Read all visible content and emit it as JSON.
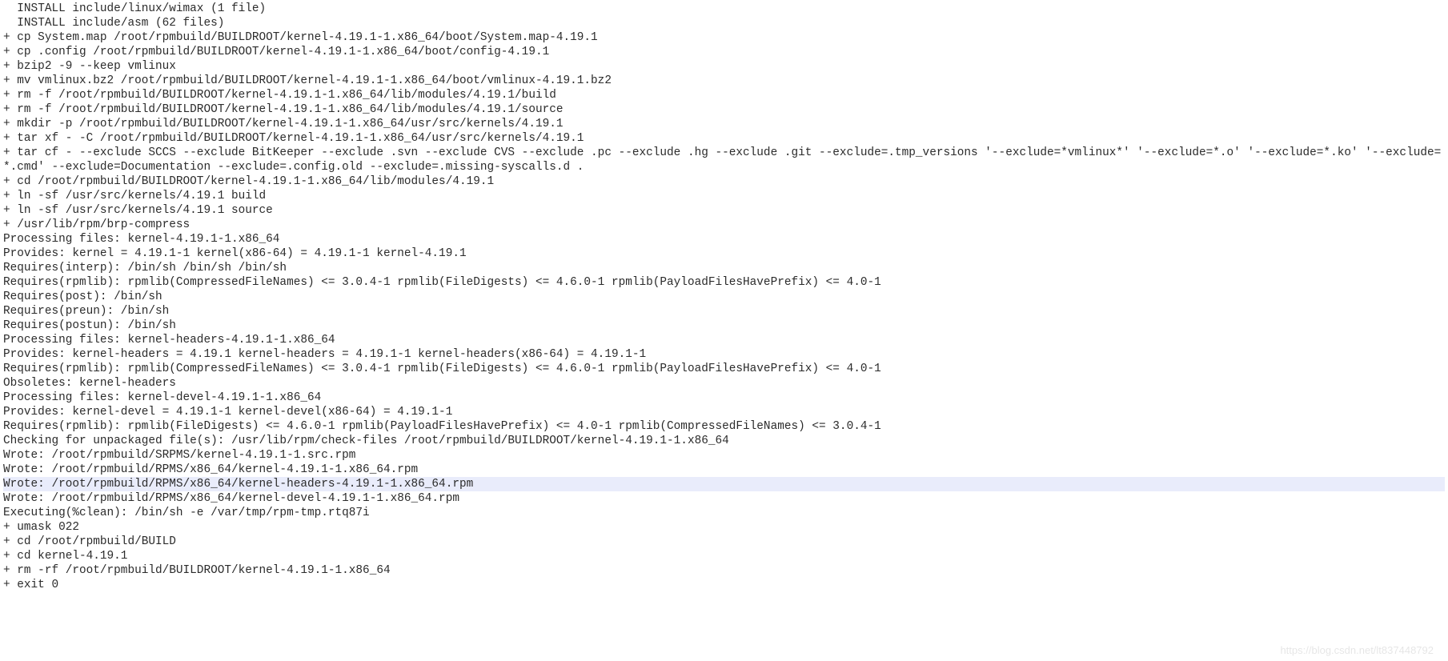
{
  "highlight_index": 33,
  "watermark": "https://blog.csdn.net/lt837448792",
  "lines": [
    "  INSTALL include/linux/wimax (1 file)",
    "  INSTALL include/asm (62 files)",
    "+ cp System.map /root/rpmbuild/BUILDROOT/kernel-4.19.1-1.x86_64/boot/System.map-4.19.1",
    "+ cp .config /root/rpmbuild/BUILDROOT/kernel-4.19.1-1.x86_64/boot/config-4.19.1",
    "+ bzip2 -9 --keep vmlinux",
    "+ mv vmlinux.bz2 /root/rpmbuild/BUILDROOT/kernel-4.19.1-1.x86_64/boot/vmlinux-4.19.1.bz2",
    "+ rm -f /root/rpmbuild/BUILDROOT/kernel-4.19.1-1.x86_64/lib/modules/4.19.1/build",
    "+ rm -f /root/rpmbuild/BUILDROOT/kernel-4.19.1-1.x86_64/lib/modules/4.19.1/source",
    "+ mkdir -p /root/rpmbuild/BUILDROOT/kernel-4.19.1-1.x86_64/usr/src/kernels/4.19.1",
    "+ tar xf - -C /root/rpmbuild/BUILDROOT/kernel-4.19.1-1.x86_64/usr/src/kernels/4.19.1",
    "+ tar cf - --exclude SCCS --exclude BitKeeper --exclude .svn --exclude CVS --exclude .pc --exclude .hg --exclude .git --exclude=.tmp_versions '--exclude=*vmlinux*' '--exclude=*.o' '--exclude=*.ko' '--exclude=*.cmd' --exclude=Documentation --exclude=.config.old --exclude=.missing-syscalls.d .",
    "+ cd /root/rpmbuild/BUILDROOT/kernel-4.19.1-1.x86_64/lib/modules/4.19.1",
    "+ ln -sf /usr/src/kernels/4.19.1 build",
    "+ ln -sf /usr/src/kernels/4.19.1 source",
    "+ /usr/lib/rpm/brp-compress",
    "Processing files: kernel-4.19.1-1.x86_64",
    "Provides: kernel = 4.19.1-1 kernel(x86-64) = 4.19.1-1 kernel-4.19.1",
    "Requires(interp): /bin/sh /bin/sh /bin/sh",
    "Requires(rpmlib): rpmlib(CompressedFileNames) <= 3.0.4-1 rpmlib(FileDigests) <= 4.6.0-1 rpmlib(PayloadFilesHavePrefix) <= 4.0-1",
    "Requires(post): /bin/sh",
    "Requires(preun): /bin/sh",
    "Requires(postun): /bin/sh",
    "Processing files: kernel-headers-4.19.1-1.x86_64",
    "Provides: kernel-headers = 4.19.1 kernel-headers = 4.19.1-1 kernel-headers(x86-64) = 4.19.1-1",
    "Requires(rpmlib): rpmlib(CompressedFileNames) <= 3.0.4-1 rpmlib(FileDigests) <= 4.6.0-1 rpmlib(PayloadFilesHavePrefix) <= 4.0-1",
    "Obsoletes: kernel-headers",
    "Processing files: kernel-devel-4.19.1-1.x86_64",
    "Provides: kernel-devel = 4.19.1-1 kernel-devel(x86-64) = 4.19.1-1",
    "Requires(rpmlib): rpmlib(FileDigests) <= 4.6.0-1 rpmlib(PayloadFilesHavePrefix) <= 4.0-1 rpmlib(CompressedFileNames) <= 3.0.4-1",
    "Checking for unpackaged file(s): /usr/lib/rpm/check-files /root/rpmbuild/BUILDROOT/kernel-4.19.1-1.x86_64",
    "Wrote: /root/rpmbuild/SRPMS/kernel-4.19.1-1.src.rpm",
    "Wrote: /root/rpmbuild/RPMS/x86_64/kernel-4.19.1-1.x86_64.rpm",
    "Wrote: /root/rpmbuild/RPMS/x86_64/kernel-headers-4.19.1-1.x86_64.rpm",
    "Wrote: /root/rpmbuild/RPMS/x86_64/kernel-devel-4.19.1-1.x86_64.rpm",
    "Executing(%clean): /bin/sh -e /var/tmp/rpm-tmp.rtq87i",
    "+ umask 022",
    "+ cd /root/rpmbuild/BUILD",
    "+ cd kernel-4.19.1",
    "+ rm -rf /root/rpmbuild/BUILDROOT/kernel-4.19.1-1.x86_64",
    "+ exit 0"
  ]
}
